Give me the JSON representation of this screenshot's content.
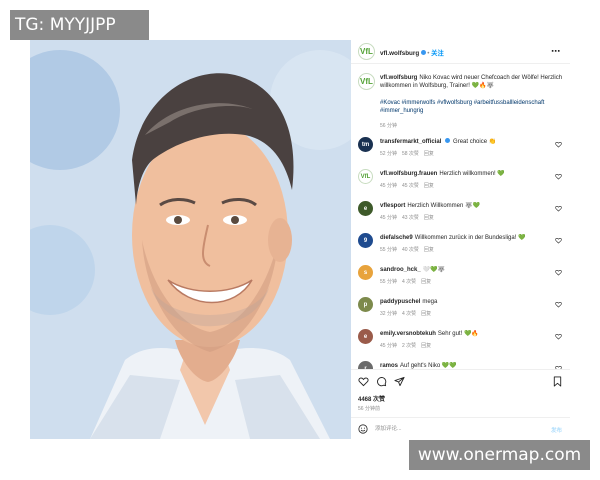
{
  "watermarks": {
    "top_left": "TG: MYYJJPP",
    "bottom_right": "www.onermap.com"
  },
  "post": {
    "username": "vfl.wolfsburg",
    "separator": "•",
    "follow_label": "关注",
    "avatar_letters": "VfL",
    "caption": "Niko Kovac wird neuer Chefcoach der Wölfe! Herzlich willkommen in Wolfsburg, Trainer! 💚🔥🐺",
    "hashtags": "#Kovac #immerwolfs #vflwolfsburg #arbeitfussballleidenschaft #immer_hungrig",
    "caption_time": "56 分钟"
  },
  "comments": [
    {
      "user": "transfermarkt_official",
      "verified": true,
      "avatar_letters": "tm",
      "avatar_color": "#1a3151",
      "text": "Great choice 👏",
      "time": "52 分钟",
      "likes": "58 次赞",
      "reply": "回复"
    },
    {
      "user": "vfl.wolfsburg.frauen",
      "verified": false,
      "avatar_letters": "VfL",
      "avatar_color": "#ffffff",
      "text": "Herzlich willkommen! 💚",
      "time": "45 分钟",
      "likes": "45 次赞",
      "reply": "回复"
    },
    {
      "user": "vflesport",
      "verified": false,
      "avatar_letters": "e",
      "avatar_color": "#3e5a2a",
      "text": "Herzlich Willkommen 🐺💚",
      "time": "45 分钟",
      "likes": "43 次赞",
      "reply": "回复"
    },
    {
      "user": "diefalsche9",
      "verified": false,
      "avatar_letters": "9",
      "avatar_color": "#1f4b8f",
      "text": "Willkommen zurück in der Bundesliga! 💚",
      "time": "55 分钟",
      "likes": "40 次赞",
      "reply": "回复"
    },
    {
      "user": "sandroo_hck_",
      "verified": false,
      "avatar_letters": "s",
      "avatar_color": "#e8a33c",
      "text": "🤍💚🐺",
      "time": "55 分钟",
      "likes": "4 次赞",
      "reply": "回复"
    },
    {
      "user": "paddypuschel",
      "verified": false,
      "avatar_letters": "p",
      "avatar_color": "#7d8a4c",
      "text": "mega",
      "time": "32 分钟",
      "likes": "4 次赞",
      "reply": "回复"
    },
    {
      "user": "emily.versnobtekuh",
      "verified": false,
      "avatar_letters": "e",
      "avatar_color": "#9a5b4a",
      "text": "Sehr gut! 💚🔥",
      "time": "45 分钟",
      "likes": "2 次赞",
      "reply": "回复"
    },
    {
      "user": "ramos",
      "verified": false,
      "avatar_letters": "r",
      "avatar_color": "#6b6b6b",
      "text": "Auf geht's Niko 💚💚",
      "time": "",
      "likes": "",
      "reply": ""
    }
  ],
  "engagement": {
    "likes": "4468 次赞",
    "time": "56 分钟前"
  },
  "comment_box": {
    "placeholder": "添加评论...",
    "post_label": "发布"
  },
  "colors": {
    "accent": "#0095f6",
    "brand_green": "#52a235",
    "heart": "#262626"
  },
  "icons": [
    "more-options-icon",
    "heart-icon",
    "comment-icon",
    "share-icon",
    "bookmark-icon",
    "emoji-icon",
    "verified-badge-icon"
  ]
}
